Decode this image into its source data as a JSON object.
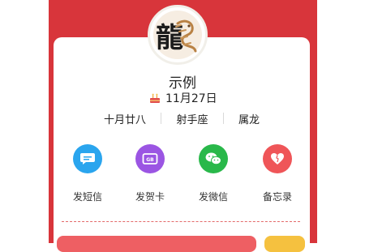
{
  "profile": {
    "avatar_char": "龍",
    "name": "示例",
    "birthday": "11月27日",
    "lunar_date": "十月廿八",
    "zodiac_sign": "射手座",
    "chinese_zodiac": "属龙"
  },
  "actions": [
    {
      "label": "发短信",
      "icon": "sms-icon",
      "color": "#2aa5ee"
    },
    {
      "label": "发贺卡",
      "icon": "greeting-card-icon",
      "color": "#9b55e3"
    },
    {
      "label": "发微信",
      "icon": "wechat-icon",
      "color": "#29b84a"
    },
    {
      "label": "备忘录",
      "icon": "heart-memo-icon",
      "color": "#ef5558"
    }
  ],
  "colors": {
    "header_red": "#d8353b",
    "button_red": "#ee5f63",
    "button_yellow": "#f5c13f"
  }
}
